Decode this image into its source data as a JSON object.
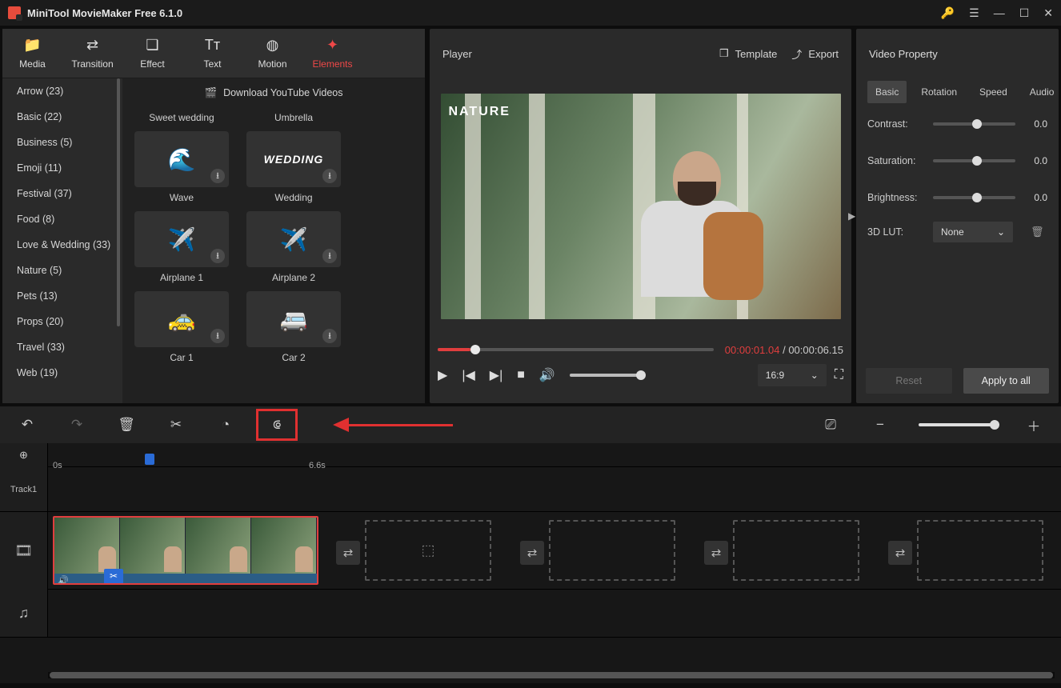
{
  "titlebar": {
    "title": "MiniTool MovieMaker Free 6.1.0"
  },
  "tabs": [
    {
      "id": "media",
      "label": "Media",
      "icon": "📁"
    },
    {
      "id": "transition",
      "label": "Transition",
      "icon": "⇄"
    },
    {
      "id": "effect",
      "label": "Effect",
      "icon": "❏"
    },
    {
      "id": "text",
      "label": "Text",
      "icon": "Tᴛ"
    },
    {
      "id": "motion",
      "label": "Motion",
      "icon": "◍"
    },
    {
      "id": "elements",
      "label": "Elements",
      "icon": "✦",
      "active": true
    }
  ],
  "download_bar": "Download YouTube Videos",
  "categories": [
    "Arrow (23)",
    "Basic (22)",
    "Business (5)",
    "Emoji (11)",
    "Festival (37)",
    "Food (8)",
    "Love & Wedding (33)",
    "Nature (5)",
    "Pets (13)",
    "Props (20)",
    "Travel (33)",
    "Web (19)"
  ],
  "elements": {
    "row0": [
      "Sweet wedding",
      "Umbrella"
    ],
    "items": [
      {
        "label": "Wave",
        "icon": "🌊"
      },
      {
        "label": "Wedding",
        "icon": "WEDDING",
        "textIcon": true
      },
      {
        "label": "Airplane 1",
        "icon": "✈️"
      },
      {
        "label": "Airplane 2",
        "icon": "✈️"
      },
      {
        "label": "Car 1",
        "icon": "🚕"
      },
      {
        "label": "Car 2",
        "icon": "🚐"
      }
    ]
  },
  "player": {
    "title": "Player",
    "template": "Template",
    "export": "Export",
    "nature_tag": "NATURE",
    "time_current": "00:00:01.04",
    "time_sep": " / ",
    "time_total": "00:00:06.15",
    "ratio": "16:9"
  },
  "property": {
    "title": "Video Property",
    "tabs": [
      "Basic",
      "Rotation",
      "Speed",
      "Audio"
    ],
    "sliders": [
      {
        "label": "Contrast:",
        "value": "0.0"
      },
      {
        "label": "Saturation:",
        "value": "0.0"
      },
      {
        "label": "Brightness:",
        "value": "0.0"
      }
    ],
    "lut_label": "3D LUT:",
    "lut_value": "None",
    "reset": "Reset",
    "apply": "Apply to all"
  },
  "timeline": {
    "t0": "0s",
    "t66": "6.6s",
    "track1": "Track1"
  }
}
